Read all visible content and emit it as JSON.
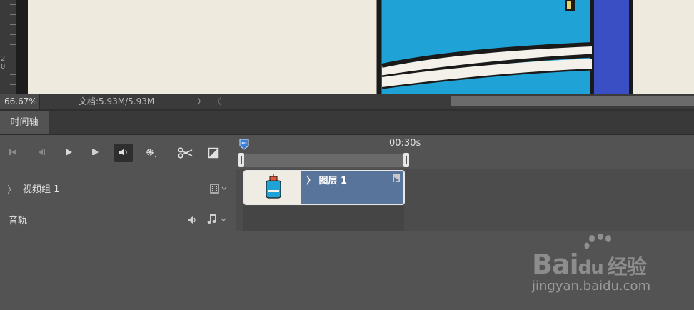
{
  "canvas": {
    "ruler_labels": [
      "2",
      "0"
    ]
  },
  "status_bar": {
    "zoom": "66.67%",
    "doc_info": "文档:5.93M/5.93M",
    "expand_arrow": "〉",
    "scroll_left_arrow": "〈"
  },
  "panel": {
    "tab_label": "时间轴"
  },
  "controls": [
    {
      "name": "go-to-first-frame",
      "icon": "skip-start-icon"
    },
    {
      "name": "previous-frame",
      "icon": "step-back-icon"
    },
    {
      "name": "play",
      "icon": "play-icon"
    },
    {
      "name": "next-frame",
      "icon": "step-forward-icon"
    },
    {
      "name": "audio-toggle",
      "icon": "speaker-icon"
    },
    {
      "name": "settings",
      "icon": "gear-icon"
    },
    {
      "name": "split",
      "icon": "scissors-icon"
    },
    {
      "name": "transition",
      "icon": "transition-icon"
    }
  ],
  "timeline": {
    "time_label": "00:30s"
  },
  "tracks": {
    "video": {
      "expand": "〉",
      "label": "视频组 1",
      "clip_label": "〉 图层 1"
    },
    "audio": {
      "label": "音轨"
    }
  },
  "watermark": {
    "brand": "Bai",
    "brand2": "du",
    "cn": "经验",
    "url": "jingyan.baidu.com"
  },
  "colors": {
    "accent_blue": "#3b7fd6",
    "clip_blue": "#59749a",
    "playhead_red": "#cc3333"
  }
}
